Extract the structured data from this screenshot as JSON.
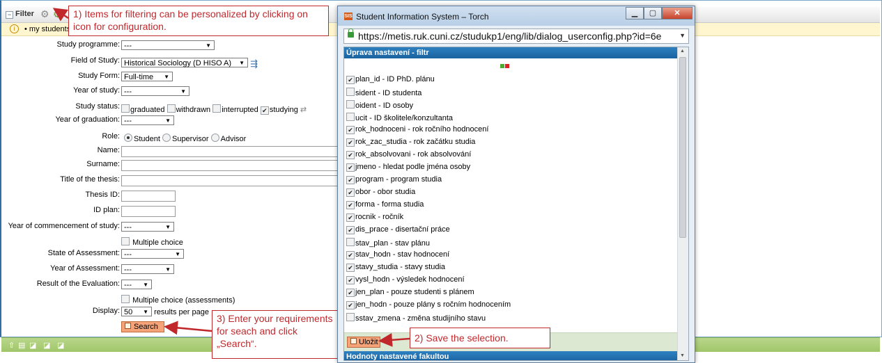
{
  "filter": {
    "title": "Filter"
  },
  "mystudents": {
    "label": "my students"
  },
  "form": {
    "study_programme": {
      "label": "Study programme:",
      "value": "---"
    },
    "field_of_study": {
      "label": "Field of Study:",
      "value": "Historical Sociology (D HISO A)"
    },
    "study_form": {
      "label": "Study Form:",
      "value": "Full-time"
    },
    "year_of_study": {
      "label": "Year of study:",
      "value": "---"
    },
    "study_status": {
      "label": "Study status:",
      "options": [
        {
          "label": "graduated",
          "checked": false
        },
        {
          "label": "withdrawn",
          "checked": false
        },
        {
          "label": "interrupted",
          "checked": false
        },
        {
          "label": "studying",
          "checked": true
        }
      ]
    },
    "year_of_graduation": {
      "label": "Year of graduation:",
      "value": "---"
    },
    "role": {
      "label": "Role:",
      "options": [
        {
          "label": "Student",
          "selected": true
        },
        {
          "label": "Supervisor",
          "selected": false
        },
        {
          "label": "Advisor",
          "selected": false
        }
      ]
    },
    "name": {
      "label": "Name:"
    },
    "surname": {
      "label": "Surname:"
    },
    "title_of_thesis": {
      "label": "Title of the thesis:"
    },
    "thesis_id": {
      "label": "Thesis ID:"
    },
    "id_plan": {
      "label": "ID plan:"
    },
    "year_of_commencement": {
      "label": "Year of commencement of study:",
      "value": "---"
    },
    "multiple_choice": {
      "label": "Multiple choice"
    },
    "state_of_assessment": {
      "label": "State of Assessment:",
      "value": "---"
    },
    "year_of_assessment": {
      "label": "Year of Assessment:",
      "value": "---"
    },
    "result_of_evaluation": {
      "label": "Result of the Evaluation:",
      "value": "---"
    },
    "multiple_choice_assessments": {
      "label": "Multiple choice (assessments)"
    },
    "display": {
      "label": "Display:",
      "value": "50",
      "suffix": "results per page"
    },
    "search_label": "Search"
  },
  "callouts": {
    "c1": "1) Items for filtering can be personalized by clicking on icon for configuration.",
    "c2": "2) Save the selection.",
    "c3": "3) Enter your requirements for seach and click „Search“."
  },
  "dialog": {
    "title": "Student Information System – Torch",
    "url": "https://metis.ruk.cuni.cz/studukp1/eng/lib/dialog_userconfig.php?id=6e",
    "section_title": "Úprava nastavení - filtr",
    "save_label": "Uložit",
    "section2_title": "Hodnoty nastavené fakultou",
    "items": [
      {
        "label": "plan_id - ID PhD. plánu",
        "checked": true
      },
      {
        "label": "sident - ID studenta",
        "checked": false
      },
      {
        "label": "oident - ID osoby",
        "checked": false
      },
      {
        "label": "ucit - ID školitele/konzultanta",
        "checked": false
      },
      {
        "label": "rok_hodnoceni - rok ročního hodnocení",
        "checked": true
      },
      {
        "label": "rok_zac_studia - rok začátku studia",
        "checked": true
      },
      {
        "label": "rok_absolvovani - rok absolvování",
        "checked": true
      },
      {
        "label": "jmeno - hledat podle jména osoby",
        "checked": true
      },
      {
        "label": "program - program studia",
        "checked": true
      },
      {
        "label": "obor - obor studia",
        "checked": true
      },
      {
        "label": "forma - forma studia",
        "checked": true
      },
      {
        "label": "rocnik - ročník",
        "checked": true
      },
      {
        "label": "dis_prace - disertační práce",
        "checked": true
      },
      {
        "label": "stav_plan - stav plánu",
        "checked": false
      },
      {
        "label": "stav_hodn - stav hodnocení",
        "checked": true
      },
      {
        "label": "stavy_studia - stavy studia",
        "checked": true
      },
      {
        "label": "vysl_hodn - výsledek hodnocení",
        "checked": true
      },
      {
        "label": "jen_plan - pouze studenti s plánem",
        "checked": true
      },
      {
        "label": "jen_hodn - pouze plány s ročním hodnocením",
        "checked": true
      },
      {
        "label": "sstav_zmena - změna studijního stavu",
        "checked": false
      }
    ]
  },
  "colors": {
    "accent": "#1a62a0",
    "callout": "#c0282c",
    "button": "#f5a47a",
    "bar": "#a0c56a"
  }
}
